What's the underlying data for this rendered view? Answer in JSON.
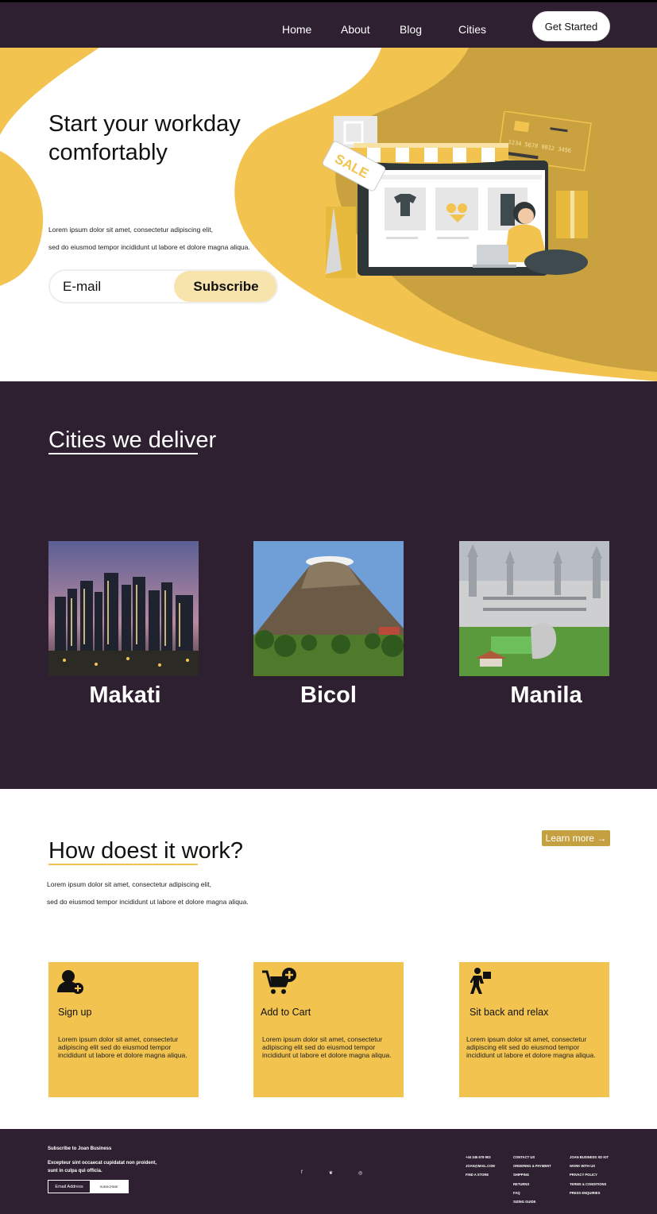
{
  "nav": {
    "links": [
      "Home",
      "About",
      "Blog",
      "Cities"
    ],
    "cta": "Get Started"
  },
  "hero": {
    "title": "Start your workday comfortably",
    "sub1": "Lorem ipsum dolor sit amet, consectetur adipiscing elit,",
    "sub2": "sed do eiusmod tempor incididunt ut labore et dolore magna aliqua.",
    "email_placeholder": "E-mail",
    "subscribe": "Subscribe",
    "illustration": {
      "sale_tag": "SALE",
      "card_number": "1234 5678 9012 3456"
    }
  },
  "cities": {
    "title": "Cities we deliver",
    "items": [
      {
        "name": "Makati",
        "image": "city-skyline-night"
      },
      {
        "name": "Bicol",
        "image": "volcano-landscape"
      },
      {
        "name": "Manila",
        "image": "cathedral-garden"
      }
    ]
  },
  "how": {
    "title": "How doest it work?",
    "learn_more": "Learn more →",
    "sub1": "Lorem ipsum dolor sit amet, consectetur adipiscing elit,",
    "sub2": "sed do eiusmod tempor incididunt ut labore et dolore magna aliqua.",
    "cards": [
      {
        "icon": "user-plus-icon",
        "title": "Sign up",
        "text": "Lorem ipsum dolor sit amet, consectetur adipiscing elit sed do eiusmod tempor incididunt ut labore et dolore magna aliqua."
      },
      {
        "icon": "cart-add-icon",
        "title": "Add to Cart",
        "text": "Lorem ipsum dolor sit amet, consectetur adipiscing elit sed do eiusmod tempor incididunt ut labore et dolore magna aliqua."
      },
      {
        "icon": "delivery-person-icon",
        "title": "Sit back and relax",
        "text": "Lorem ipsum dolor sit amet, consectetur adipiscing elit sed do eiusmod tempor incididunt ut labore et dolore magna aliqua."
      }
    ],
    "colors": {
      "card": "#f2c44f",
      "underline": "#f2c44f",
      "learn_more": "#c4a040"
    }
  },
  "footer": {
    "subscribe_title": "Subscribe to Joan  Business",
    "subscribe_text": "Excepteur sint occaecat cupidatat non proident, sunt in culpa qui officia.",
    "email_label": "Email Address",
    "subscribe_button": "SUBSCRIBE",
    "social": [
      "facebook-icon",
      "twitter-icon",
      "instagram-icon"
    ],
    "col1": [
      "+44 345 678 903",
      "JOAN@MAIL.COM",
      "FIND A STORE"
    ],
    "col2": [
      "CONTACT US",
      "ORDERING & PAYMENT",
      "SHIPPING",
      "RETURNS",
      "FAQ",
      "SIZING GUIDE"
    ],
    "col3": [
      "JOAN BUSINESS XD KIT",
      "WORK WITH US",
      "PRIVACY POLICY",
      "TERMS & CONDITIONS",
      "PRESS ENQUIRIES"
    ]
  },
  "colors": {
    "dark": "#2e2030",
    "yellow": "#f2c44f",
    "gold": "#c9a23f"
  }
}
